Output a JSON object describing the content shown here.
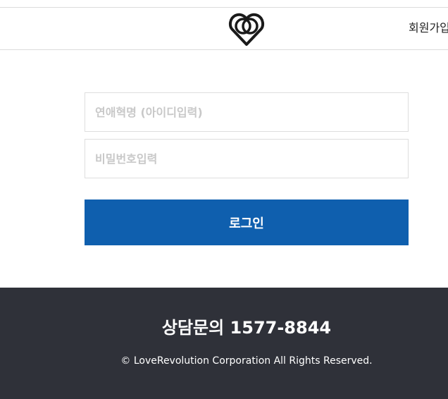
{
  "header": {
    "logo_icon": "interlocking-hearts-logo-icon",
    "signup_label": "회원가입"
  },
  "login_form": {
    "username_placeholder": "연애혁명 (아이디입력)",
    "password_placeholder": "비밀번호입력",
    "submit_label": "로그인",
    "accent_color": "#0f5fae"
  },
  "footer": {
    "phone_text": "상담문의 1577-8844",
    "copyright": "© LoveRevolution Corporation All Rights Reserved.",
    "background_color": "#2f3139"
  }
}
